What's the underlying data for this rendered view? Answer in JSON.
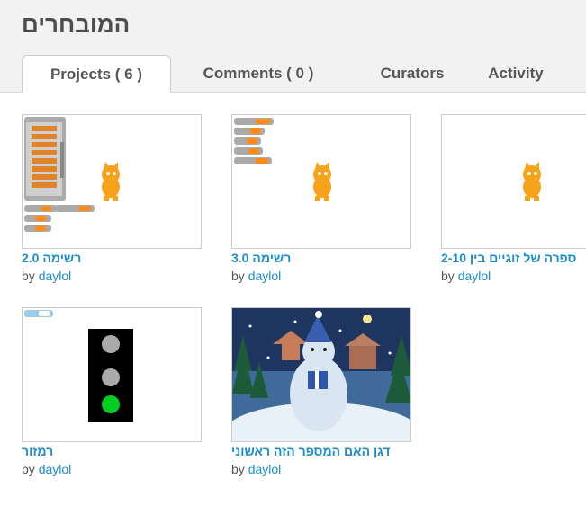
{
  "page": {
    "title": "המובחרים"
  },
  "tabs": [
    {
      "label": "Projects ( 6 )",
      "active": true
    },
    {
      "label": "Comments ( 0 )",
      "active": false
    },
    {
      "label": "Curators",
      "active": false
    },
    {
      "label": "Activity",
      "active": false
    }
  ],
  "by_label": "by",
  "projects": [
    {
      "name": "רשימה 2.0",
      "author": "daylol",
      "thumb": "list-blocks-cat"
    },
    {
      "name": "רשימה 3.0",
      "author": "daylol",
      "thumb": "variables-cat"
    },
    {
      "name": "ספרה של זוגיים בין 2-10",
      "author": "daylol",
      "thumb": "cat"
    },
    {
      "name": "רמזור",
      "author": "daylol",
      "thumb": "traffic-light"
    },
    {
      "name": "דגן האם המספר הזה ראשוני",
      "author": "daylol",
      "thumb": "snow-yeti"
    }
  ],
  "colors": {
    "link": "#1a8ccf",
    "title": "#4d4d4d",
    "header_bg": "#f2f2f2"
  }
}
